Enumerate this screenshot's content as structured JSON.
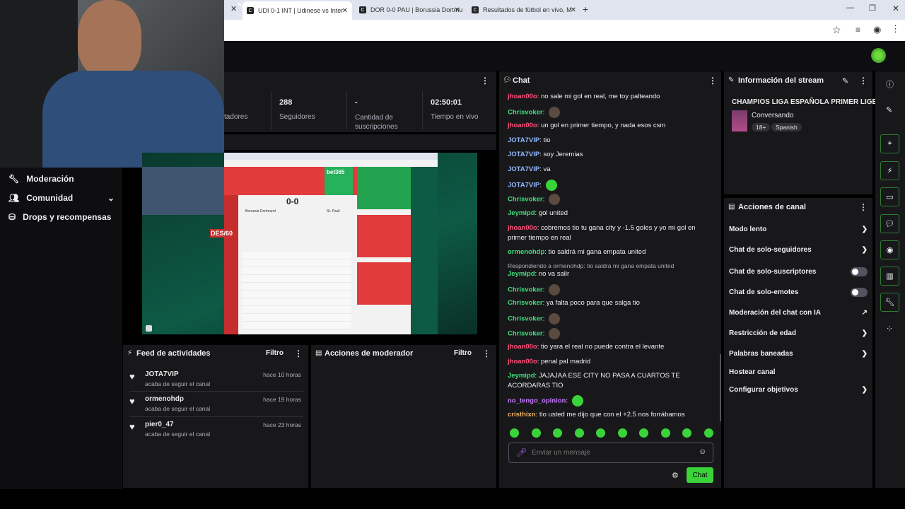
{
  "browser": {
    "tabs": [
      {
        "label": "UDI 0-1 INT | Udinese vs Inter"
      },
      {
        "label": "DOR 0-0 PAU | Borussia Dortmu"
      },
      {
        "label": "Resultados de fútbol en vivo, M"
      }
    ],
    "new_tab": "+"
  },
  "stats": {
    "viewers_label": "tadores",
    "followers_value": "288",
    "followers_label": "Seguidores",
    "subs_value": "-",
    "subs_label": "Cantidad de suscripciones",
    "time_value": "02:50:01",
    "time_label": "Tiempo en vivo"
  },
  "sidebar": {
    "items": [
      {
        "label": "Moderación"
      },
      {
        "label": "Comunidad"
      },
      {
        "label": "Drops y recompensas"
      }
    ]
  },
  "preview": {
    "score": "0-0",
    "team1": "Borussia Dortmund",
    "team2": "St. Pauli",
    "promo": "DES/60",
    "brand": "bet365"
  },
  "feed": {
    "title": "Feed de actividades",
    "filter": "Filtro",
    "items": [
      {
        "user": "JOTA7VIP",
        "action": "acaba de seguir el canal",
        "time": "hace 10 horas"
      },
      {
        "user": "ormenohdp",
        "action": "acaba de seguir el canal",
        "time": "hace 19 horas"
      },
      {
        "user": "pier0_47",
        "action": "acaba de seguir el canal",
        "time": "hace 23 horas"
      }
    ]
  },
  "modactions": {
    "title": "Acciones de moderador",
    "filter": "Filtro"
  },
  "chat": {
    "title": "Chat",
    "messages": [
      {
        "user": "jhoan00o",
        "text": ": no sale mi gol en real, me toy palteando",
        "color": "#ff4f7b"
      },
      {
        "user": "Chrisvoker",
        "text": ":",
        "color": "#3ee07a"
      },
      {
        "user": "jhoan00o",
        "text": ": un gol en primer tiempo, y nada esos csm",
        "color": "#ff4f7b"
      },
      {
        "user": "JOTA7VIP",
        "text": ": tio",
        "color": "#8fb8ff"
      },
      {
        "user": "JOTA7VIP",
        "text": ": soy Jeremias",
        "color": "#8fb8ff"
      },
      {
        "user": "JOTA7VIP",
        "text": ": va",
        "color": "#8fb8ff"
      },
      {
        "user": "JOTA7VIP",
        "text": ":",
        "color": "#8fb8ff"
      },
      {
        "user": "Chrisvoker",
        "text": ":",
        "color": "#3ee07a"
      },
      {
        "user": "Jeymipd",
        "text": ": gol united",
        "color": "#3ee07a"
      },
      {
        "user": "jhoan00o",
        "text": ": cobremos tio tu gana city y -1.5 goles y yo mi gol en primer tiempo en real",
        "color": "#ff4f7b"
      },
      {
        "user": "ormenohdp",
        "text": ": tio saldrá mi gana empata united",
        "color": "#3ee07a"
      },
      {
        "user": "",
        "text": "Respondiendo a ormenohdp: tio saldrá mi gana empata united",
        "color": "#adadb8"
      },
      {
        "user": "Jeymipd",
        "text": ": no va salir",
        "color": "#3ee07a"
      },
      {
        "user": "Chrisvoker",
        "text": ":",
        "color": "#3ee07a"
      },
      {
        "user": "Chrisvoker",
        "text": ": ya falta poco para que salga tio",
        "color": "#3ee07a"
      },
      {
        "user": "Chrisvoker",
        "text": ":",
        "color": "#3ee07a"
      },
      {
        "user": "Chrisvoker",
        "text": ":",
        "color": "#3ee07a"
      },
      {
        "user": "jhoan00o",
        "text": ": tio yara el real no puede contra el levante",
        "color": "#ff4f7b"
      },
      {
        "user": "jhoan00o",
        "text": ": penal pal madrid",
        "color": "#ff4f7b"
      },
      {
        "user": "Jeymipd",
        "text": ": JAJAJAA ESE CITY NO PASA A CUARTOS TE ACORDARAS TIO",
        "color": "#3ee07a"
      },
      {
        "user": "no_tengo_opinion",
        "text": ":",
        "color": "#c678ff"
      },
      {
        "user": "cristhixn",
        "text": ": tio usted me dijo que con el +2.5 nos forrábamos",
        "color": "#f0b060"
      }
    ],
    "placeholder": "Enviar un mensaje",
    "send_label": "Chat"
  },
  "stream_info": {
    "title": "Información del stream",
    "stream_title": "CHAMPIOS LIGA ESPAÑOLA PRIMER LIGE",
    "category": "Conversando",
    "tags": [
      "18+",
      "Spanish"
    ]
  },
  "channel_actions": {
    "title": "Acciones de canal",
    "items": [
      {
        "label": "Modo lento"
      },
      {
        "label": "Chat de solo-seguidores"
      },
      {
        "label": "Chat de solo-suscriptores"
      },
      {
        "label": "Chat de solo-emotes"
      },
      {
        "label": "Moderación del chat con IA"
      },
      {
        "label": "Restricción de edad"
      },
      {
        "label": "Palabras baneadas"
      },
      {
        "label": "Hostear canal"
      },
      {
        "label": "Configurar objetivos"
      }
    ]
  },
  "colors": {
    "accent": "#3ad33a",
    "panel": "#18181b",
    "bg": "#0e0e10"
  }
}
